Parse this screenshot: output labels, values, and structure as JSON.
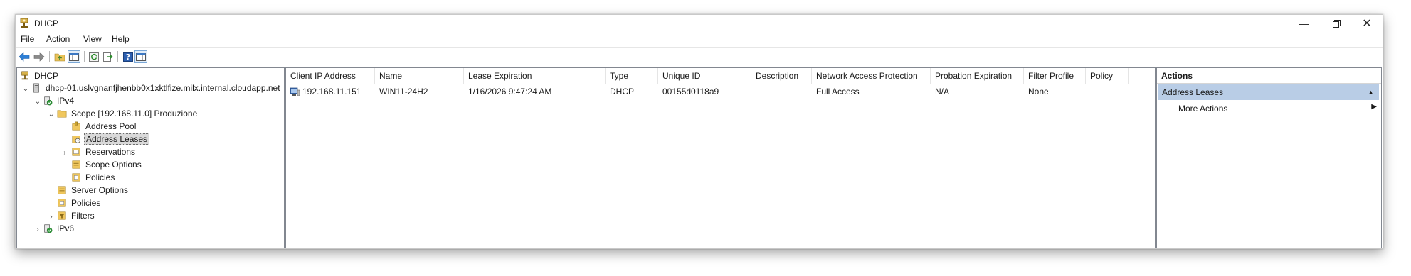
{
  "window": {
    "title": "DHCP"
  },
  "menu": [
    "File",
    "Action",
    "View",
    "Help"
  ],
  "tree": {
    "root": "DHCP",
    "server": "dhcp-01.uslvgnanfjhenbb0x1xktlfize.milx.internal.cloudapp.net",
    "ipv4": "IPv4",
    "scope": "Scope [192.168.11.0] Produzione",
    "address_pool": "Address Pool",
    "address_leases": "Address Leases",
    "reservations": "Reservations",
    "scope_options": "Scope Options",
    "scope_policies": "Policies",
    "server_options": "Server Options",
    "policies": "Policies",
    "filters": "Filters",
    "ipv6": "IPv6"
  },
  "table": {
    "columns": [
      "Client IP Address",
      "Name",
      "Lease Expiration",
      "Type",
      "Unique ID",
      "Description",
      "Network Access Protection",
      "Probation Expiration",
      "Filter Profile",
      "Policy"
    ],
    "rows": [
      [
        "192.168.11.151",
        "WIN11-24H2",
        "1/16/2026 9:47:24 AM",
        "DHCP",
        "00155d0118a9",
        "",
        "Full Access",
        "N/A",
        "None",
        ""
      ]
    ]
  },
  "actions": {
    "title": "Actions",
    "section": "Address Leases",
    "items": [
      "More Actions"
    ]
  }
}
